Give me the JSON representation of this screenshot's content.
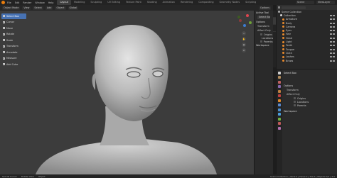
{
  "topbar": {
    "menus": [
      "File",
      "Edit",
      "Render",
      "Window",
      "Help"
    ],
    "workspaces": [
      "Layout",
      "Modeling",
      "Sculpting",
      "UV Editing",
      "Texture Paint",
      "Shading",
      "Animation",
      "Rendering",
      "Compositing",
      "Geometry Nodes",
      "Scripting"
    ],
    "active_workspace": "Layout",
    "scene": "Scene",
    "view_layer": "ViewLayer"
  },
  "header": {
    "mode": "Object Mode",
    "view": "View",
    "select": "Select",
    "add": "Add",
    "object": "Object",
    "orientation": "Global",
    "options": "Options"
  },
  "toolbar": {
    "tools": [
      {
        "label": "Select Box",
        "active": true
      },
      {
        "label": "Cursor",
        "active": false
      },
      {
        "label": "Move",
        "active": false
      },
      {
        "label": "Rotate",
        "active": false
      },
      {
        "label": "Scale",
        "active": false
      },
      {
        "label": "Transform",
        "active": false
      },
      {
        "label": "Annotate",
        "active": false
      },
      {
        "label": "Measure",
        "active": false
      },
      {
        "label": "Add Cube",
        "active": false
      }
    ]
  },
  "npanel": {
    "active_tool": "Active Tool",
    "select_box": "Select Box",
    "options": "Options",
    "transform": "Transform",
    "affect_only": "Affect Only",
    "origins": "Origins",
    "locations": "Locations",
    "parents": "Parents",
    "workspace": "Workspace",
    "tabs": [
      "Item",
      "Tool",
      "View"
    ]
  },
  "outliner": {
    "collection": "Scene Collection",
    "rows": [
      "Collection",
      "Armature",
      "Body",
      "Camera",
      "Eyes",
      "Hair",
      "Head",
      "Light",
      "Teeth",
      "Tongue",
      "Cloth",
      "Lashes",
      "Brows"
    ]
  },
  "properties": {
    "title": "Select Box",
    "options": "Options",
    "transform": "Transform",
    "affect_only": "Affect Only",
    "origins": "Origins",
    "locations": "Locations",
    "parents": "Parents",
    "workspace": "Workspace"
  },
  "statusbar": {
    "left": [
      "Set 3D Cursor",
      "Rotate View",
      "Object"
    ],
    "right": "Scene Collection | Verts 0 | Faces 0 | Tris 0 | Objects 0/1 | 4.0"
  }
}
